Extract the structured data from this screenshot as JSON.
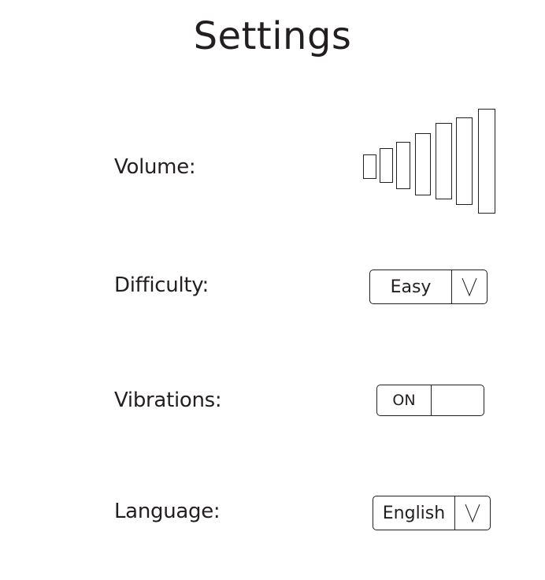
{
  "page": {
    "title": "Settings"
  },
  "volume": {
    "label": "Volume:",
    "levels_total": 7
  },
  "difficulty": {
    "label": "Difficulty:",
    "selected": "Easy",
    "arrow_icon": "chevron-down-icon"
  },
  "vibrations": {
    "label": "Vibrations:",
    "state": "ON"
  },
  "language": {
    "label": "Language:",
    "selected": "English",
    "arrow_icon": "chevron-down-icon"
  },
  "colors": {
    "text": "#231f20",
    "background": "#ffffff",
    "outline": "#231f20"
  }
}
